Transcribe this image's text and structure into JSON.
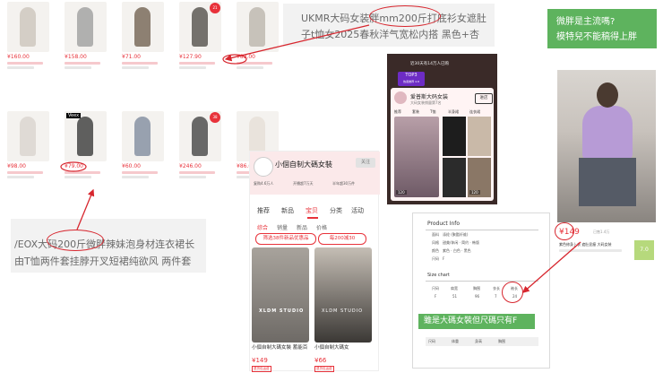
{
  "grid": {
    "items": [
      {
        "price": "¥160.00",
        "badge": "",
        "color": "#c9c2b8"
      },
      {
        "price": "¥158.00",
        "badge": "",
        "color": "#9a9a9a"
      },
      {
        "price": "¥71.00",
        "badge": "",
        "color": "#6b5a48"
      },
      {
        "price": "¥127.90",
        "badge": "21",
        "color": "#4a4540"
      },
      {
        "price": "¥83.00",
        "badge": "",
        "color": "#b8b2a8"
      },
      {
        "price": "¥98.00",
        "badge": "",
        "color": "#d8d2cc"
      },
      {
        "price": "¥79.00",
        "badge": "",
        "color": "#2e2e2e",
        "label": "Veex"
      },
      {
        "price": "¥60.00",
        "badge": "",
        "color": "#7a8599"
      },
      {
        "price": "¥246.00",
        "badge": "38",
        "color": "#3a3a3a"
      },
      {
        "price": "¥86.00",
        "badge": "",
        "color": "#e5ddd5"
      }
    ]
  },
  "callout_top": {
    "line1": "UKMR大码女装胖mm200斤打底衫女遮肚",
    "line2": "子t恤女2025春秋洋气宽松内搭 黑色+杏"
  },
  "callout_bottom": {
    "line1": "/EOX大码200斤微胖辣妹泡身材连衣裙长",
    "line2": "由T恤两件套挂脖开叉短裙纯欲风 两件套"
  },
  "green_note": {
    "line1": "微胖是主流嗎?",
    "line2": "模特兒不能稿得上胖"
  },
  "shop": {
    "name": "小個自制大碼女裝",
    "follow": "关注",
    "stat1": "复购4.6万人",
    "stat2": "开播超7万天",
    "stat3": "半年超30万件",
    "tabs": [
      "推荐",
      "新品",
      "宝贝",
      "分类",
      "活动"
    ],
    "subtabs": [
      "综合",
      "销量",
      "新品",
      "价格"
    ],
    "filter1": "筛选38件新品优惠品",
    "filter2": "每200减30",
    "card1": {
      "caption": "小個自制大碼女裝 蓄能百",
      "price": "¥149",
      "brand": "XLDM STUDIO",
      "tag": "退货包运费"
    },
    "card2": {
      "caption": "小個自制大碼女",
      "price": "¥66",
      "brand": "XLDM STUDIO",
      "tag": "退货包运费"
    }
  },
  "live": {
    "viewers": "近30天有14万人已购",
    "top": "TOP3",
    "rank": "热卖推荐 4.8",
    "shop_name": "爱普斯大码女装",
    "shop_sub": "大码女装销量第7名",
    "follow": "进店",
    "cats": [
      "推荐",
      "套装",
      "T恤",
      "半身裙",
      "连衣裙"
    ],
    "count1": "120",
    "count2": "120"
  },
  "product_info": {
    "title": "Product Info",
    "rows": [
      {
        "k": "面料",
        "v": "涤纶 (聚酯纤维)"
      },
      {
        "k": "风格",
        "v": "甜美/休闲 · 简约 · 韩版"
      },
      {
        "k": "颜色",
        "v": "紫色 · 白色 · 黑色"
      },
      {
        "k": "尺码",
        "v": "F"
      }
    ],
    "size_title": "Size chart",
    "size_heads": [
      "尺码",
      "肩宽",
      "胸围",
      "衣长",
      "袖长"
    ],
    "size_vals": [
      "F",
      "51",
      "96",
      "7",
      "24"
    ],
    "green_note": "雖是大碼女裝但尺碼只有F",
    "footer": [
      "尺码",
      "体重",
      "身高",
      "胸围"
    ]
  },
  "model": {
    "price": "¥149",
    "price_tag": "已售1.4万",
    "caption": "紫色修身上衣 遮肚显瘦 大码女装",
    "rating": "7.0"
  }
}
